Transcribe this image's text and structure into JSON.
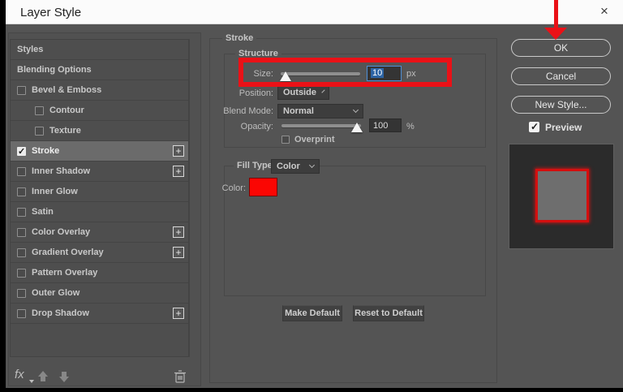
{
  "window": {
    "title": "Layer Style",
    "close_glyph": "×"
  },
  "sidebar": {
    "items": [
      {
        "label": "Styles",
        "checkbox": false,
        "checked": false,
        "indent": false,
        "add": false,
        "selected": false
      },
      {
        "label": "Blending Options",
        "checkbox": false,
        "checked": false,
        "indent": false,
        "add": false,
        "selected": false
      },
      {
        "label": "Bevel & Emboss",
        "checkbox": true,
        "checked": false,
        "indent": false,
        "add": false,
        "selected": false
      },
      {
        "label": "Contour",
        "checkbox": true,
        "checked": false,
        "indent": true,
        "add": false,
        "selected": false
      },
      {
        "label": "Texture",
        "checkbox": true,
        "checked": false,
        "indent": true,
        "add": false,
        "selected": false
      },
      {
        "label": "Stroke",
        "checkbox": true,
        "checked": true,
        "indent": false,
        "add": true,
        "selected": true
      },
      {
        "label": "Inner Shadow",
        "checkbox": true,
        "checked": false,
        "indent": false,
        "add": true,
        "selected": false
      },
      {
        "label": "Inner Glow",
        "checkbox": true,
        "checked": false,
        "indent": false,
        "add": false,
        "selected": false
      },
      {
        "label": "Satin",
        "checkbox": true,
        "checked": false,
        "indent": false,
        "add": false,
        "selected": false
      },
      {
        "label": "Color Overlay",
        "checkbox": true,
        "checked": false,
        "indent": false,
        "add": true,
        "selected": false
      },
      {
        "label": "Gradient Overlay",
        "checkbox": true,
        "checked": false,
        "indent": false,
        "add": true,
        "selected": false
      },
      {
        "label": "Pattern Overlay",
        "checkbox": true,
        "checked": false,
        "indent": false,
        "add": false,
        "selected": false
      },
      {
        "label": "Outer Glow",
        "checkbox": true,
        "checked": false,
        "indent": false,
        "add": false,
        "selected": false
      },
      {
        "label": "Drop Shadow",
        "checkbox": true,
        "checked": false,
        "indent": false,
        "add": true,
        "selected": false
      }
    ],
    "footer": {
      "fx_label": "fx",
      "plus_glyph": "+"
    }
  },
  "panel": {
    "group_title": "Stroke",
    "structure": {
      "title": "Structure",
      "size_label": "Size:",
      "size_value": "10",
      "size_unit": "px",
      "position_label": "Position:",
      "position_value": "Outside",
      "blend_mode_label": "Blend Mode:",
      "blend_mode_value": "Normal",
      "opacity_label": "Opacity:",
      "opacity_value": "100",
      "opacity_unit": "%",
      "overprint_label": "Overprint"
    },
    "fill": {
      "fill_type_label": "Fill Type:",
      "fill_type_value": "Color",
      "color_label": "Color:"
    },
    "footer_buttons": {
      "make_default": "Make Default",
      "reset_to_default": "Reset to Default"
    }
  },
  "actions": {
    "ok": "OK",
    "cancel": "Cancel",
    "new_style": "New Style...",
    "preview": "Preview"
  },
  "colors": {
    "stroke_swatch": "#fb0603",
    "annotation_red": "#ea1117",
    "focus_blue": "#4d8ed6",
    "selection_blue": "#2d64a4"
  },
  "slider_state": {
    "size_thumb_percent": 6,
    "opacity_thumb_percent": 95
  }
}
